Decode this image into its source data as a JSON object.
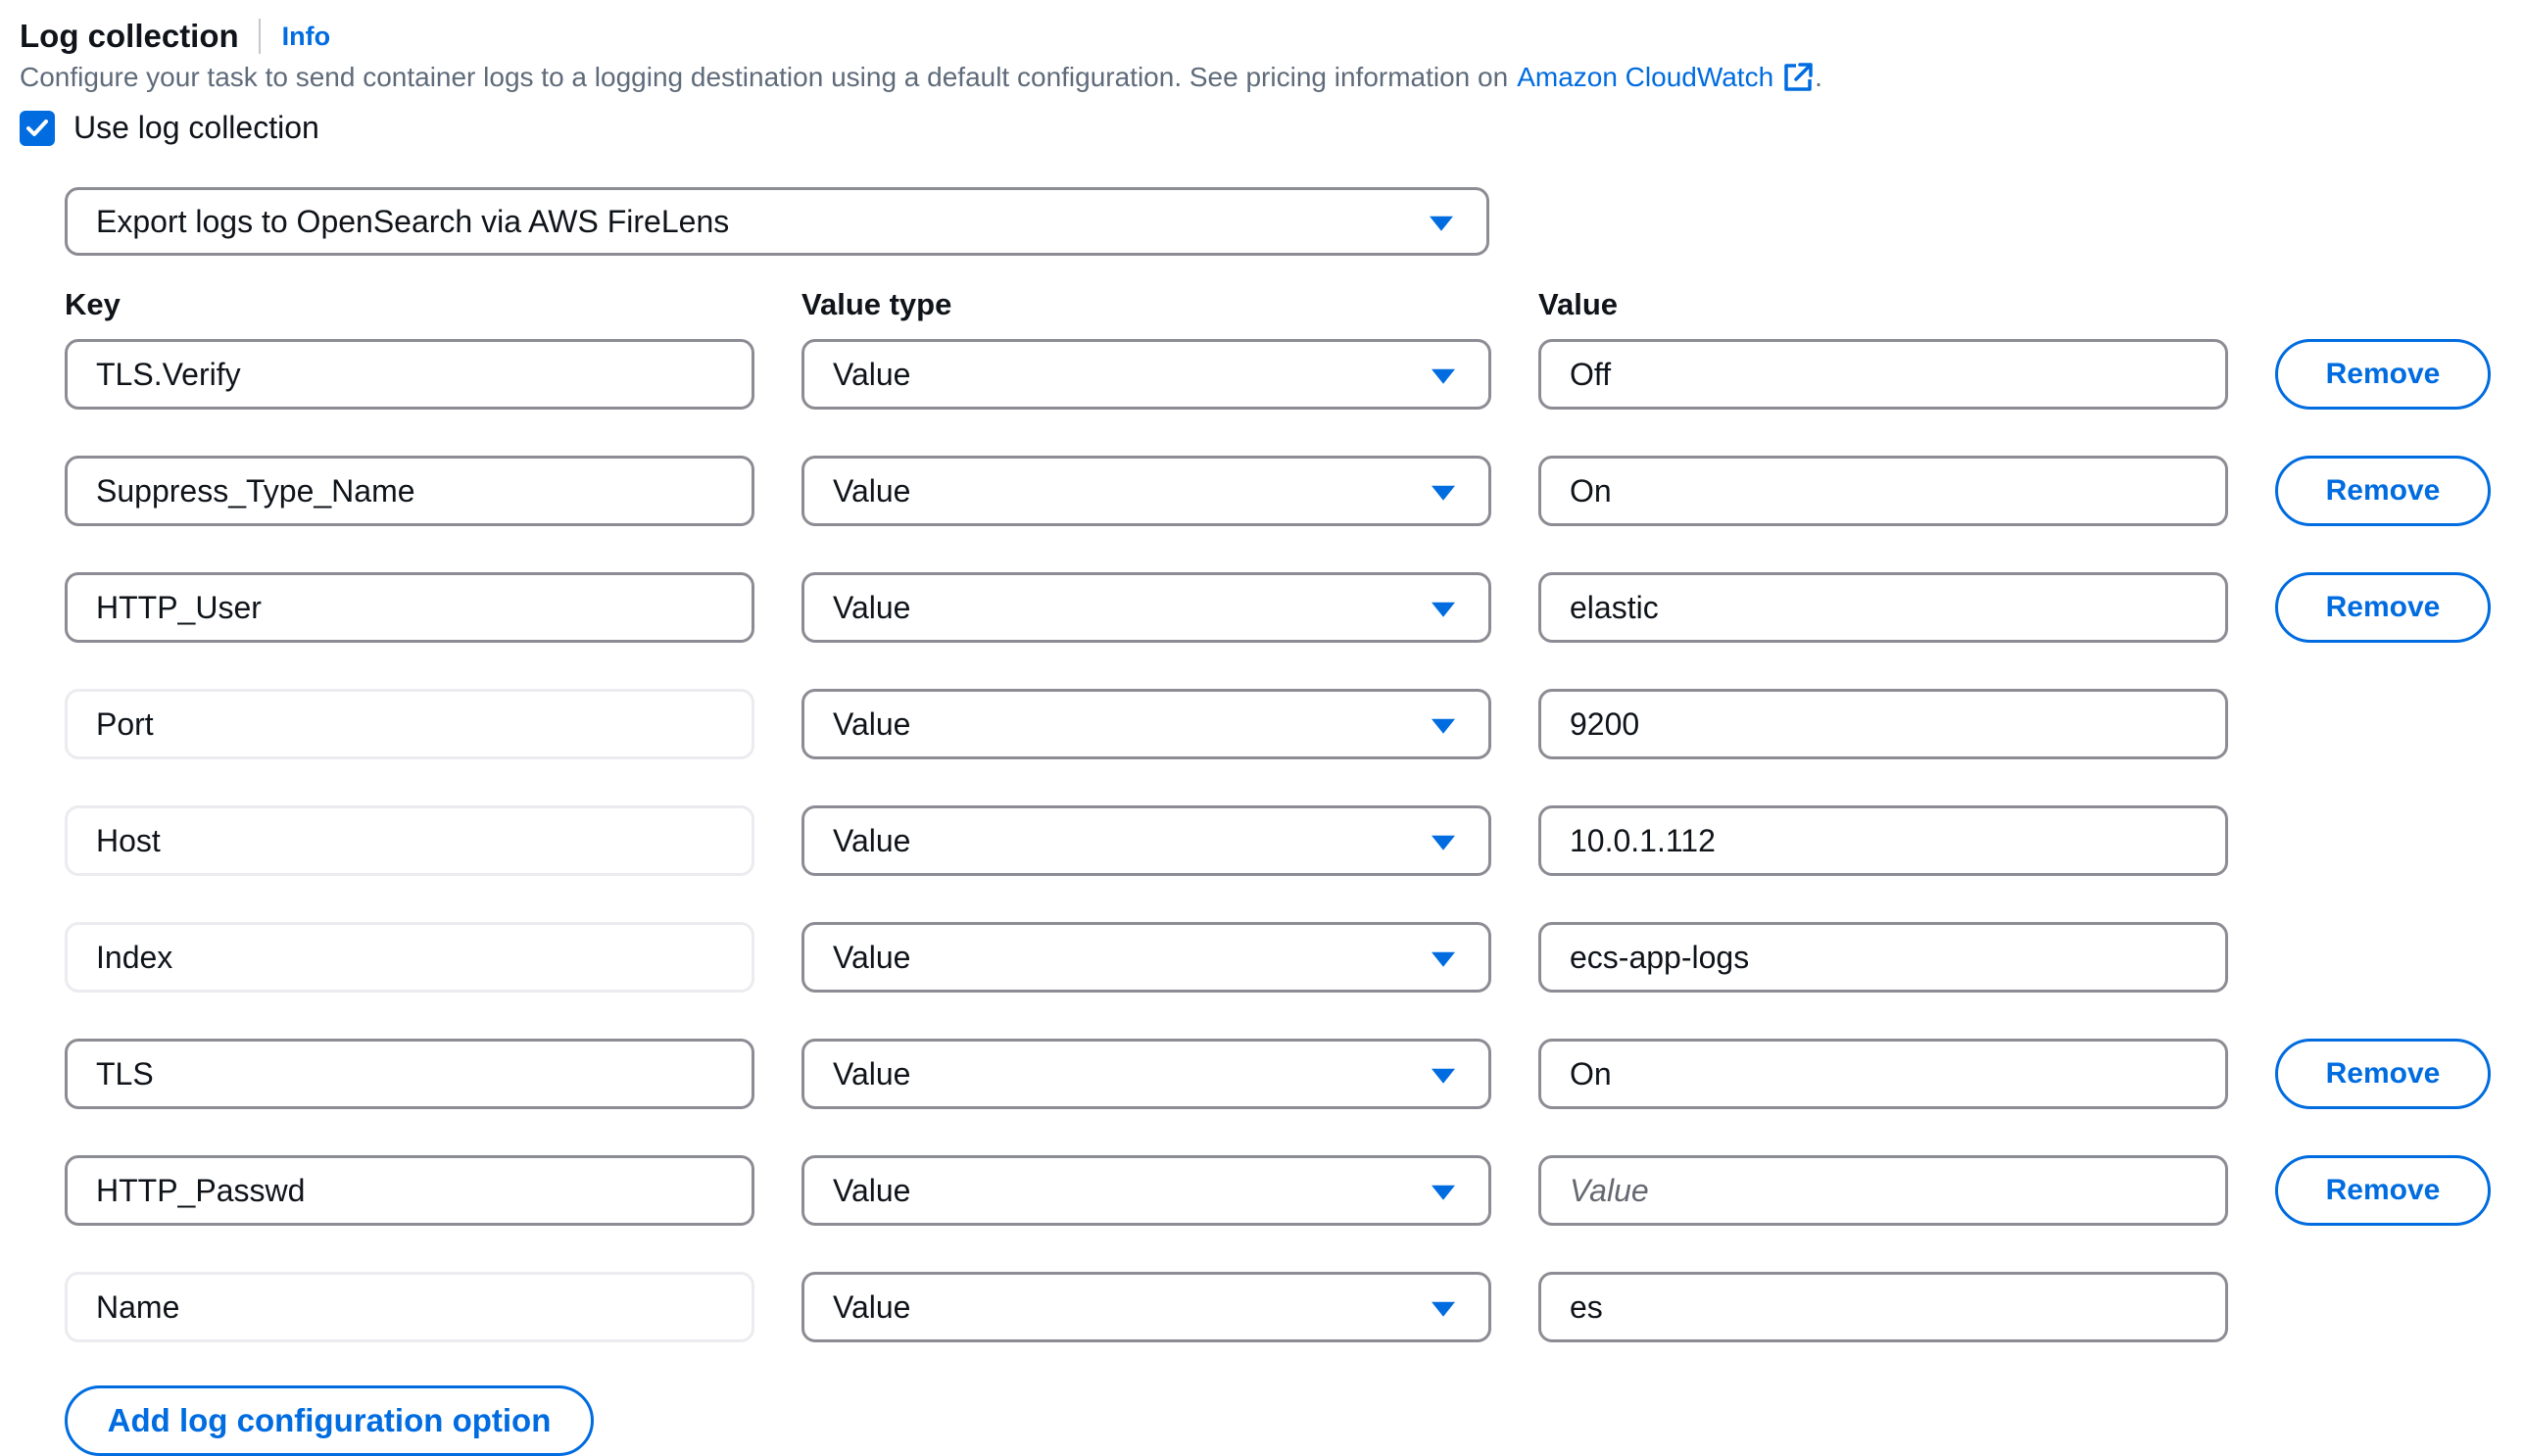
{
  "section": {
    "title": "Log collection",
    "info_link": "Info",
    "description_prefix": "Configure your task to send container logs to a logging destination using a default configuration. See pricing information on",
    "cloudwatch_link": "Amazon CloudWatch",
    "description_suffix": "."
  },
  "use_log_collection": {
    "label": "Use log collection",
    "checked": true
  },
  "destination": {
    "selected": "Export logs to OpenSearch via AWS FireLens"
  },
  "columns": {
    "key": "Key",
    "value_type": "Value type",
    "value": "Value"
  },
  "options": [
    {
      "key": "TLS.Verify",
      "value_type": "Value",
      "value": "Off",
      "remove": "Remove"
    },
    {
      "key": "Suppress_Type_Name",
      "value_type": "Value",
      "value": "On",
      "remove": "Remove"
    },
    {
      "key": "HTTP_User",
      "value_type": "Value",
      "value": "elastic",
      "remove": "Remove"
    },
    {
      "key": "Port",
      "value_type": "Value",
      "value": "9200"
    },
    {
      "key": "Host",
      "value_type": "Value",
      "value": "10.0.1.112"
    },
    {
      "key": "Index",
      "value_type": "Value",
      "value": "ecs-app-logs"
    },
    {
      "key": "TLS",
      "value_type": "Value",
      "value": "On",
      "remove": "Remove"
    },
    {
      "key": "HTTP_Passwd",
      "value_type": "Value",
      "value": "",
      "placeholder": "Value",
      "remove": "Remove"
    },
    {
      "key": "Name",
      "value_type": "Value",
      "value": "es"
    }
  ],
  "add_button": "Add log configuration option",
  "colors": {
    "accent": "#006ce0",
    "border": "#8c8c94",
    "disabled_border": "#ebebf0",
    "muted_text": "#5f6b7a"
  }
}
